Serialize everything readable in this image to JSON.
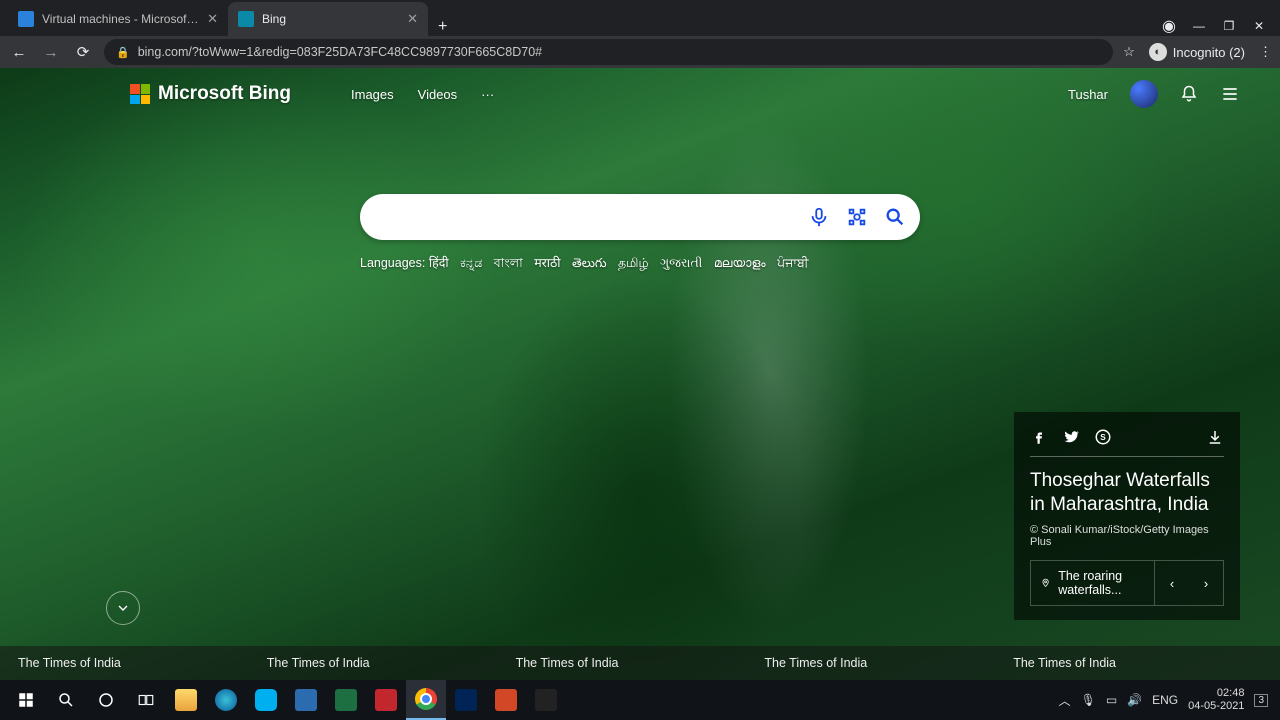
{
  "chrome": {
    "tabs": [
      {
        "title": "Virtual machines - Microsoft Azu",
        "active": false,
        "favicon": "#2a82da"
      },
      {
        "title": "Bing",
        "active": true,
        "favicon": "#0a8aa8"
      }
    ],
    "url": "bing.com/?toWww=1&redig=083F25DA73FC48CC9897730F665C8D70#",
    "incognito_label": "Incognito (2)"
  },
  "bing": {
    "brand": "Microsoft Bing",
    "nav": {
      "images": "Images",
      "videos": "Videos",
      "more": "···"
    },
    "user": "Tushar",
    "search_placeholder": "",
    "languages_label": "Languages:",
    "languages": [
      "हिंदी",
      "ಕನ್ನಡ",
      "বাংলা",
      "मराठी",
      "తెలుగు",
      "தமிழ்",
      "ગુજરાતી",
      "മലയാളം",
      "ਪੰਜਾਬੀ"
    ],
    "info": {
      "title": "Thoseghar Waterfalls in Maharashtra, India",
      "credit": "© Sonali Kumar/iStock/Getty Images Plus",
      "teaser": "The roaring waterfalls..."
    },
    "news": [
      "The Times of India",
      "The Times of India",
      "The Times of India",
      "The Times of India",
      "The Times of India"
    ]
  },
  "taskbar": {
    "lang": "ENG",
    "time": "02:48",
    "date": "04-05-2021",
    "ime": "3"
  }
}
